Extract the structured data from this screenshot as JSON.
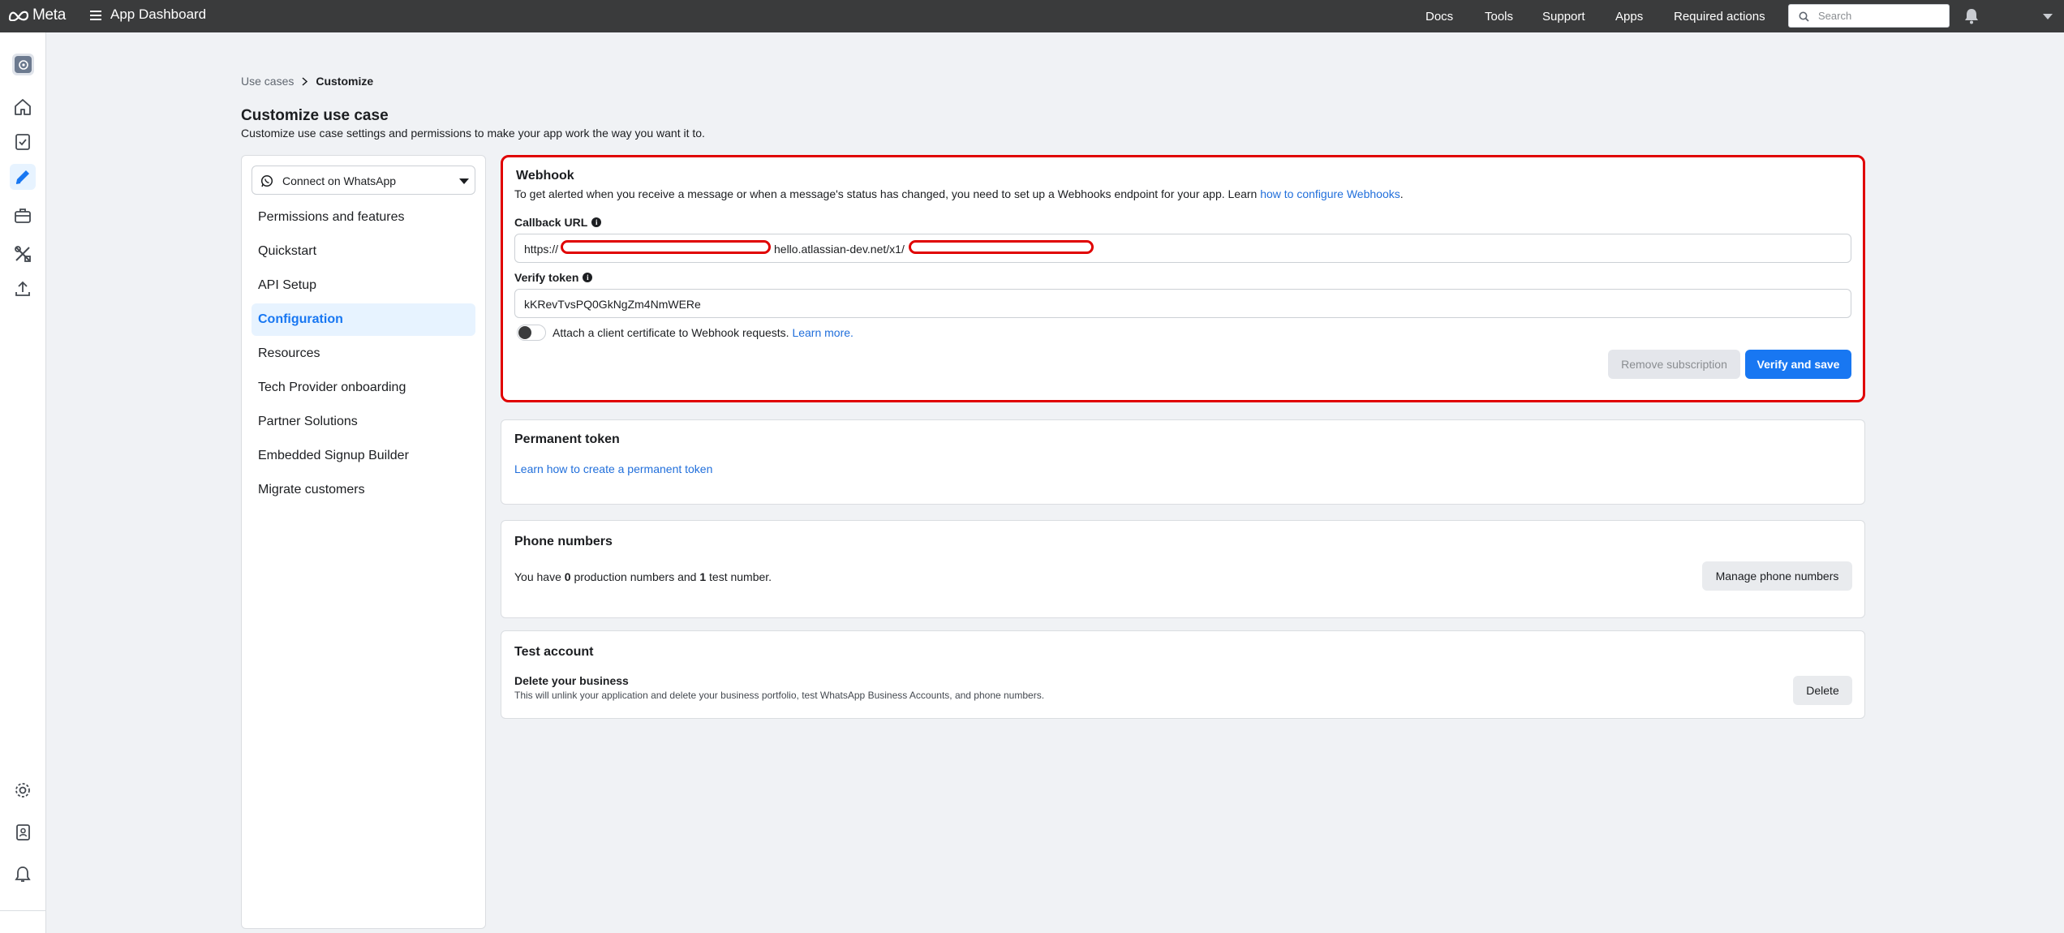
{
  "topbar": {
    "logo_text": "Meta",
    "app_title": "App Dashboard",
    "nav": [
      "Docs",
      "Tools",
      "Support",
      "Apps",
      "Required actions"
    ],
    "search_placeholder": "Search"
  },
  "breadcrumb": {
    "parent": "Use cases",
    "current": "Customize"
  },
  "page": {
    "title": "Customize use case",
    "subtitle": "Customize use case settings and permissions to make your app work the way you want it to."
  },
  "sidenav": {
    "selected_use_case": "Connect on WhatsApp",
    "items": [
      {
        "label": "Permissions and features",
        "active": false
      },
      {
        "label": "Quickstart",
        "active": false
      },
      {
        "label": "API Setup",
        "active": false
      },
      {
        "label": "Configuration",
        "active": true
      },
      {
        "label": "Resources",
        "active": false
      },
      {
        "label": "Tech Provider onboarding",
        "active": false
      },
      {
        "label": "Partner Solutions",
        "active": false
      },
      {
        "label": "Embedded Signup Builder",
        "active": false
      },
      {
        "label": "Migrate customers",
        "active": false
      }
    ]
  },
  "webhook": {
    "title": "Webhook",
    "description": "To get alerted when you receive a message or when a message's status has changed, you need to set up a Webhooks endpoint for your app. Learn ",
    "description_link": "how to configure Webhooks",
    "description_end": ".",
    "callback_label": "Callback URL",
    "callback_prefix": "https://",
    "callback_middle": "hello.atlassian-dev.net/x1/",
    "verify_label": "Verify token",
    "verify_value": "kKRevTvsPQ0GkNgZm4NmWERe",
    "cert_label": "Attach a client certificate to Webhook requests.",
    "cert_link": "Learn more.",
    "cert_enabled": false,
    "remove_button": "Remove subscription",
    "save_button": "Verify and save"
  },
  "permanent_token": {
    "title": "Permanent token",
    "link": "Learn how to create a permanent token"
  },
  "phone_numbers": {
    "title": "Phone numbers",
    "text_1": "You have ",
    "production_count": "0",
    "text_2": " production numbers and ",
    "test_count": "1",
    "text_3": " test number.",
    "button": "Manage phone numbers"
  },
  "test_account": {
    "title": "Test account",
    "heading": "Delete your business",
    "description": "This will unlink your application and delete your business portfolio, test WhatsApp Business Accounts, and phone numbers.",
    "button": "Delete"
  },
  "colors": {
    "accent": "#1877f2",
    "highlight_outline": "#e00000",
    "topbar": "#3a3b3c"
  },
  "icons": {
    "rail": [
      "app-icon",
      "home-icon",
      "checklist-icon",
      "pencil-icon",
      "briefcase-icon",
      "tools-icon",
      "upload-icon",
      "settings-icon",
      "contacts-icon",
      "bell-icon"
    ]
  }
}
